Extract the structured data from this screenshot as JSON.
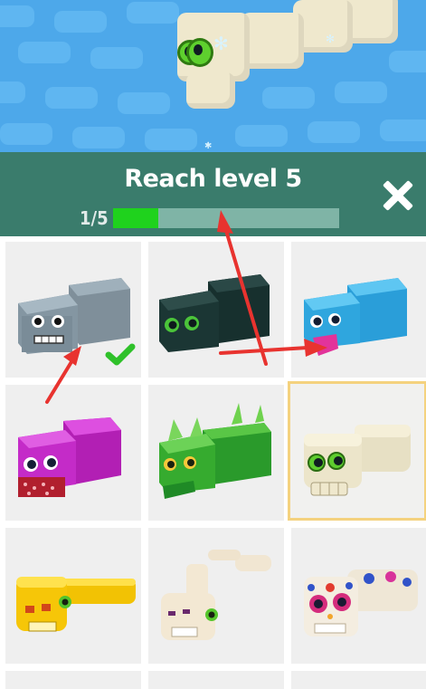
{
  "banner": {
    "title": "Reach level 5",
    "progress_text": "1/5",
    "progress_fraction": 0.2,
    "close_icon": "close-icon"
  },
  "colors": {
    "water": "#4da8ea",
    "banner": "#3a7c6c",
    "progress_fill": "#1fd21d",
    "progress_track": "#7fb4a6",
    "cell": "#efefef",
    "selected_border": "#f4d27e",
    "check": "#2fc12a",
    "annotation_arrow": "#e8332f"
  },
  "skins": [
    {
      "name": "grey-robot-snake",
      "owned": true
    },
    {
      "name": "dark-green-snake",
      "owned": false
    },
    {
      "name": "blue-tongue-snake",
      "owned": false
    },
    {
      "name": "magenta-snake",
      "owned": false
    },
    {
      "name": "green-dragon-snake",
      "owned": false
    },
    {
      "name": "bone-snake",
      "owned": false,
      "selected": true
    },
    {
      "name": "yellow-snake",
      "owned": false
    },
    {
      "name": "skeleton-snake",
      "owned": false
    },
    {
      "name": "sugar-skull-snake",
      "owned": false
    }
  ]
}
